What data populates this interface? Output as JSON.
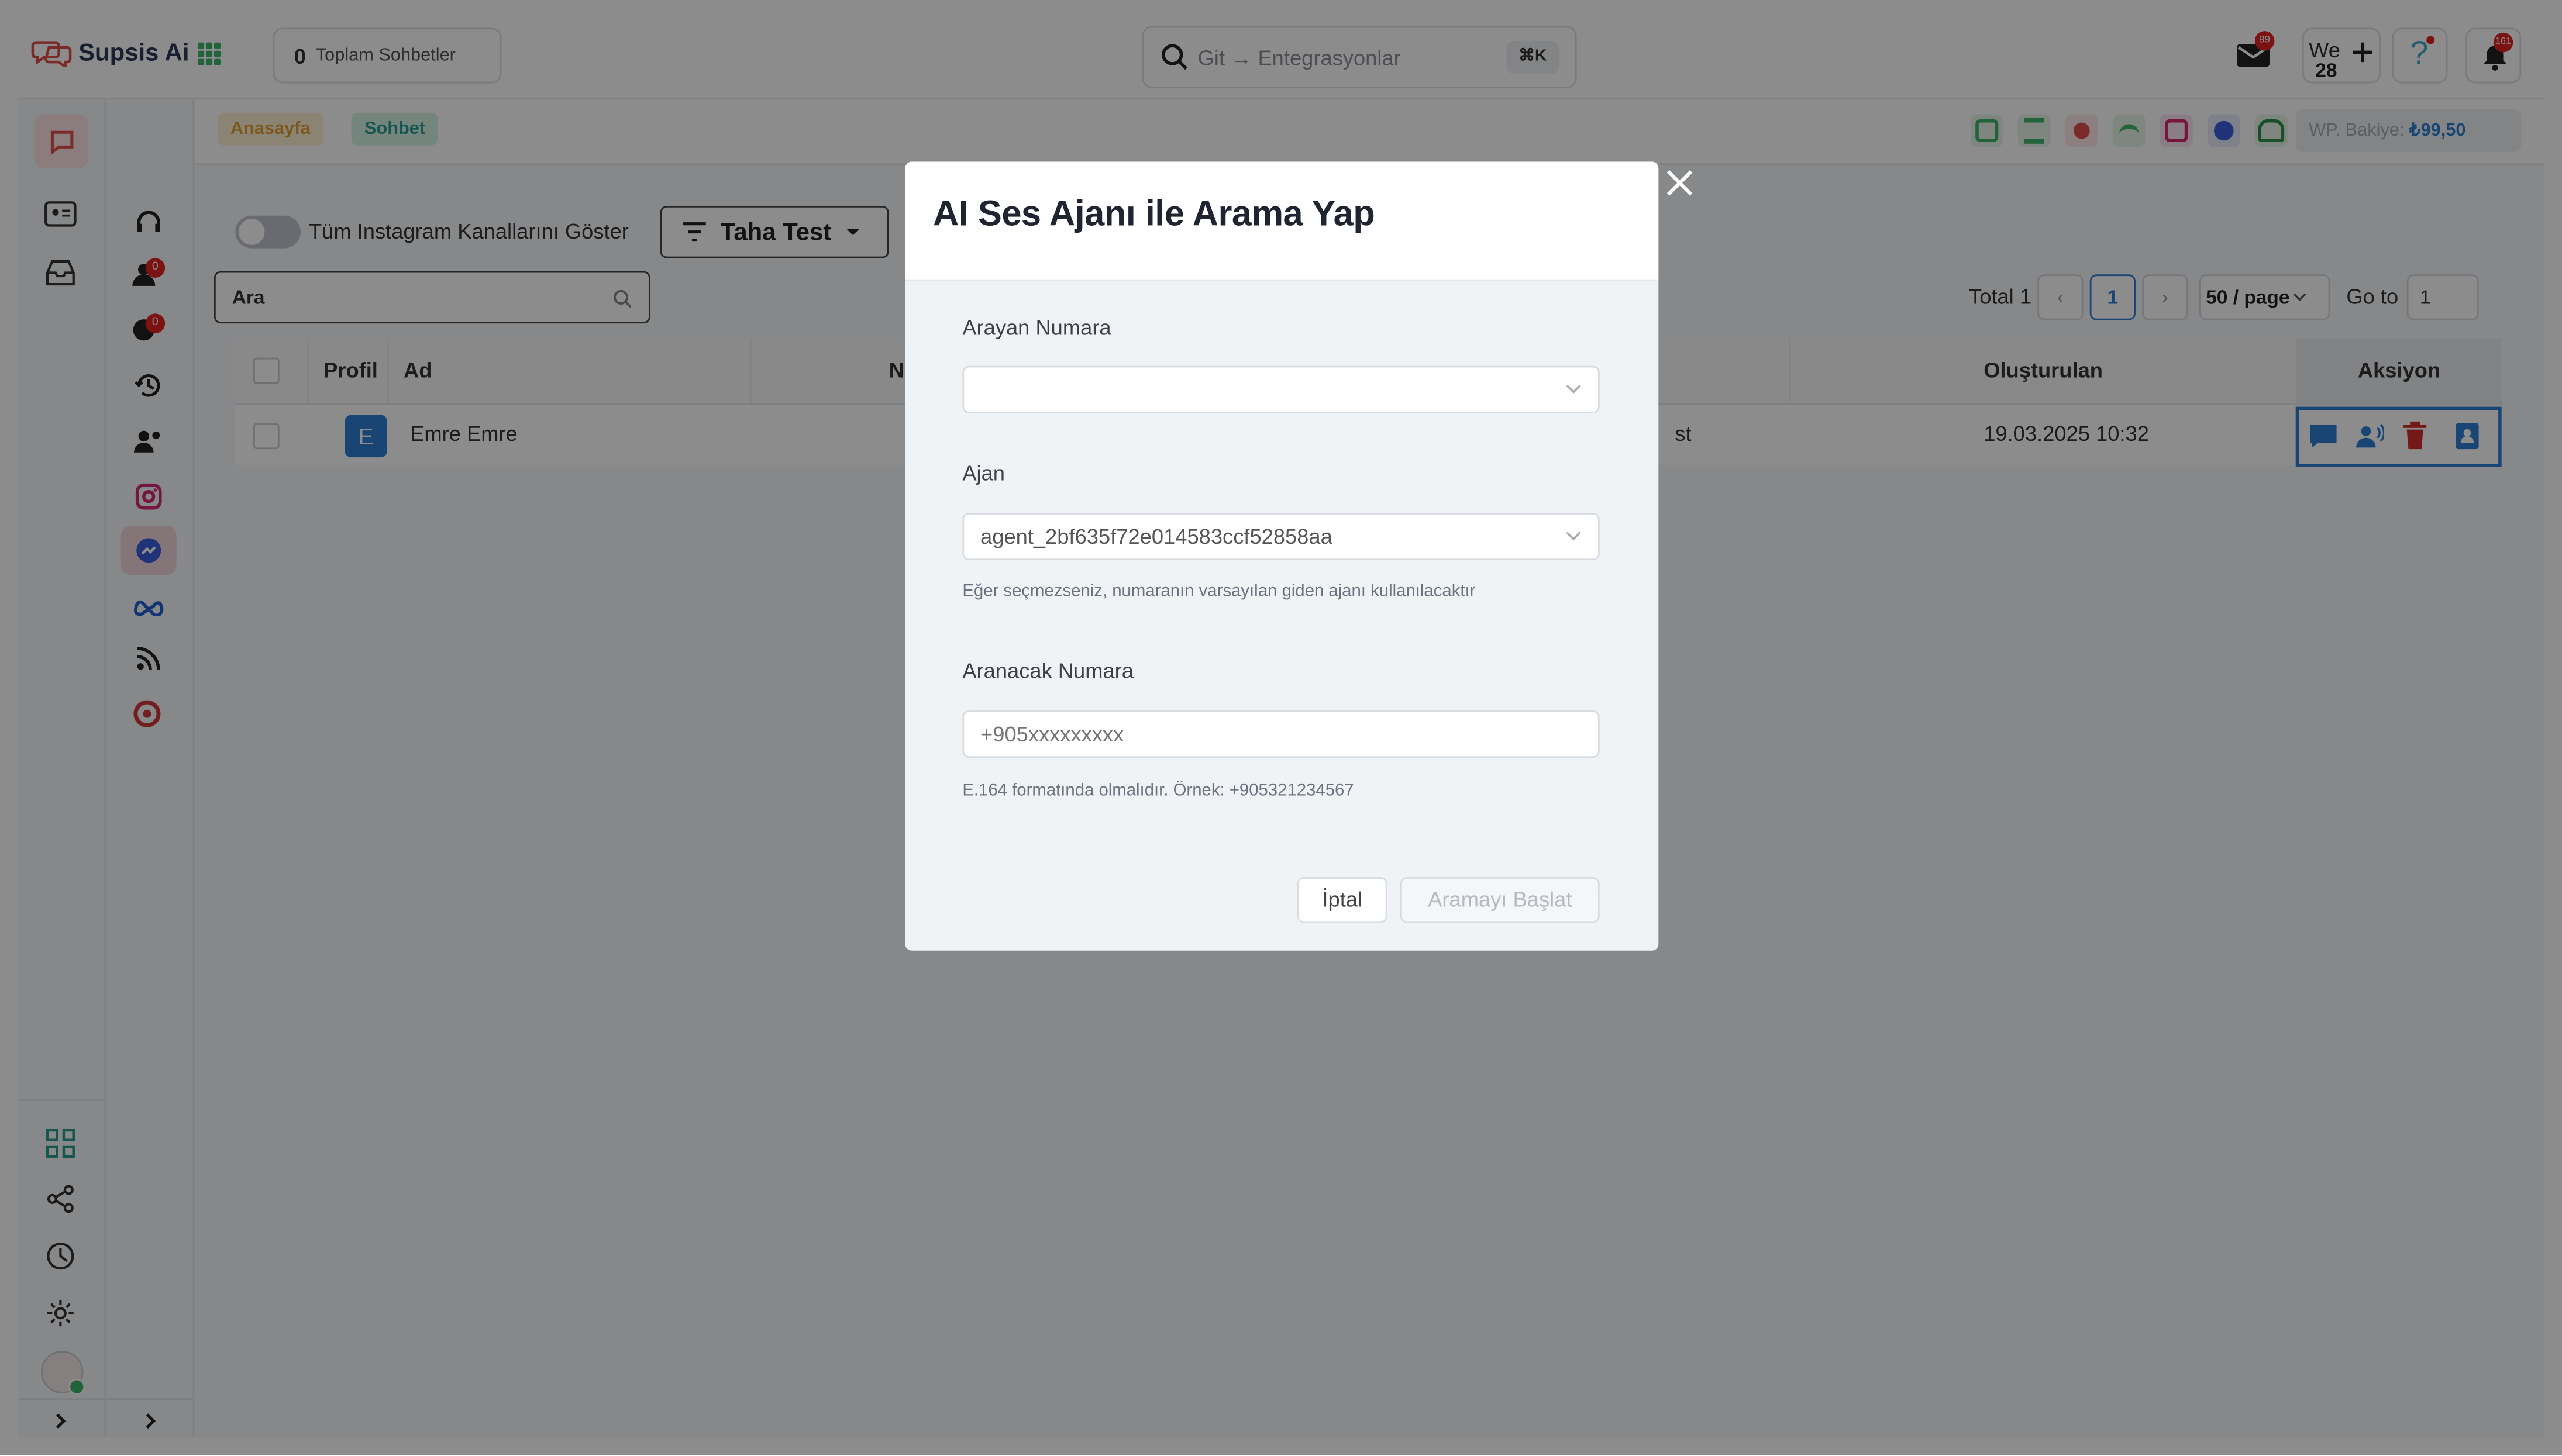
{
  "app": {
    "name": "Supsis Ai"
  },
  "header": {
    "chat_count": "0",
    "chat_count_label": "Toplam Sohbetler",
    "search_placeholder": "Git → Entegrasyonlar",
    "shortcut": "⌘K",
    "mail_badge": "99",
    "we_label": "We",
    "we_number": "28",
    "notif_badge": "161"
  },
  "breadcrumbs": [
    "Anasayfa",
    "Sohbet"
  ],
  "channel_bar": {
    "balance_label": "WP. Bakiye:",
    "balance_value": "₺99,50"
  },
  "rail_badges": {
    "assigned": "0",
    "waiting": "0"
  },
  "toolbar": {
    "toggle_label": "Tüm Instagram Kanallarını Göster",
    "filter_label": "Taha Test",
    "search_value": "Ara"
  },
  "pagination": {
    "total": "Total 1",
    "current_page": "1",
    "page_size": "50 / page",
    "goto_label": "Go to",
    "goto_value": "1"
  },
  "table": {
    "columns": {
      "profile": "Profil",
      "name": "Ad",
      "partial": "N",
      "created": "Oluşturulan",
      "action": "Aksiyon"
    },
    "rows": [
      {
        "avatar": "E",
        "name": "Emre Emre",
        "partial": "st",
        "created": "19.03.2025 10:32"
      }
    ]
  },
  "modal": {
    "title": "AI Ses Ajanı ile Arama Yap",
    "caller_label": "Arayan Numara",
    "caller_value": "",
    "agent_label": "Ajan",
    "agent_value": "agent_2bf635f72e014583ccf52858aa",
    "agent_hint": "Eğer seçmezseniz, numaranın varsayılan giden ajanı kullanılacaktır",
    "target_label": "Aranacak Numara",
    "target_placeholder": "+905xxxxxxxxx",
    "target_hint": "E.164 formatında olmalıdır. Örnek: +905321234567",
    "cancel_label": "İptal",
    "start_label": "Aramayı Başlat"
  },
  "colors": {
    "accent": "#2f7fd6",
    "brand_red": "#e04e4e",
    "crumb_home_bg": "#fdf1d6",
    "crumb_chat_bg": "#d4f2e6",
    "delete_red": "#d32f2f"
  }
}
